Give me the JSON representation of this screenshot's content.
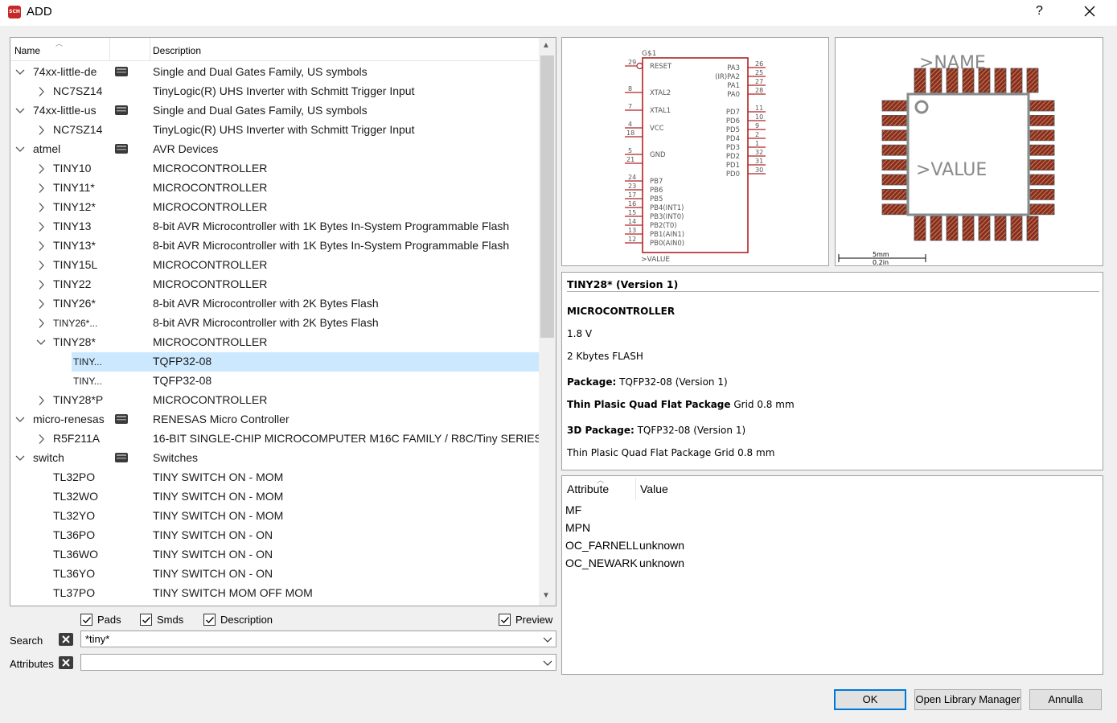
{
  "window": {
    "title": "ADD",
    "help": "?",
    "app_icon_text": "SCH"
  },
  "tree": {
    "header": {
      "name": "Name",
      "description": "Description"
    },
    "rows": [
      {
        "level": 0,
        "arrow": "down",
        "name": "74xx-little-de",
        "lib": true,
        "desc": "Single and Dual Gates Family, US symbols"
      },
      {
        "level": 1,
        "arrow": "right",
        "name": "NC7SZ14",
        "desc": "TinyLogic(R) UHS Inverter with Schmitt Trigger Input"
      },
      {
        "level": 0,
        "arrow": "down",
        "name": "74xx-little-us",
        "lib": true,
        "desc": "Single and Dual Gates Family, US symbols"
      },
      {
        "level": 1,
        "arrow": "right",
        "name": "NC7SZ14",
        "desc": "TinyLogic(R) UHS Inverter with Schmitt Trigger Input"
      },
      {
        "level": 0,
        "arrow": "down",
        "name": "atmel",
        "lib": true,
        "desc": "AVR Devices"
      },
      {
        "level": 1,
        "arrow": "right",
        "name": "TINY10",
        "desc": "MICROCONTROLLER"
      },
      {
        "level": 1,
        "arrow": "right",
        "name": "TINY11*",
        "desc": "MICROCONTROLLER"
      },
      {
        "level": 1,
        "arrow": "right",
        "name": "TINY12*",
        "desc": "MICROCONTROLLER"
      },
      {
        "level": 1,
        "arrow": "right",
        "name": "TINY13",
        "desc": "8-bit AVR Microcontroller with 1K Bytes In-System Programmable Flash"
      },
      {
        "level": 1,
        "arrow": "right",
        "name": "TINY13*",
        "desc": "8-bit AVR Microcontroller with 1K Bytes In-System Programmable Flash"
      },
      {
        "level": 1,
        "arrow": "right",
        "name": "TINY15L",
        "desc": "MICROCONTROLLER"
      },
      {
        "level": 1,
        "arrow": "right",
        "name": "TINY22",
        "desc": "MICROCONTROLLER"
      },
      {
        "level": 1,
        "arrow": "right",
        "name": "TINY26*",
        "desc": "8-bit AVR Microcontroller with 2K Bytes Flash"
      },
      {
        "level": 1,
        "arrow": "right",
        "name": "TINY26*...",
        "desc": "8-bit AVR Microcontroller with 2K Bytes Flash",
        "small": true
      },
      {
        "level": 1,
        "arrow": "down",
        "name": "TINY28*",
        "desc": "MICROCONTROLLER"
      },
      {
        "level": 2,
        "arrow": "",
        "name": "TINY...",
        "desc": "TQFP32-08",
        "selected": true,
        "small": true
      },
      {
        "level": 2,
        "arrow": "",
        "name": "TINY...",
        "desc": "TQFP32-08",
        "small": true
      },
      {
        "level": 1,
        "arrow": "right",
        "name": "TINY28*P",
        "desc": "MICROCONTROLLER"
      },
      {
        "level": 0,
        "arrow": "down",
        "name": "micro-renesas",
        "lib": true,
        "desc": "RENESAS Micro Controller"
      },
      {
        "level": 1,
        "arrow": "right",
        "name": "R5F211A",
        "desc": "16-BIT SINGLE-CHIP MICROCOMPUTER M16C FAMILY / R8C/Tiny SERIES"
      },
      {
        "level": 0,
        "arrow": "down",
        "name": "switch",
        "lib": true,
        "desc": "Switches"
      },
      {
        "level": 1,
        "arrow": "",
        "name": "TL32PO",
        "desc": "TINY SWITCH ON - MOM"
      },
      {
        "level": 1,
        "arrow": "",
        "name": "TL32WO",
        "desc": "TINY SWITCH ON - MOM"
      },
      {
        "level": 1,
        "arrow": "",
        "name": "TL32YO",
        "desc": "TINY SWITCH ON - MOM"
      },
      {
        "level": 1,
        "arrow": "",
        "name": "TL36PO",
        "desc": "TINY SWITCH ON - ON"
      },
      {
        "level": 1,
        "arrow": "",
        "name": "TL36WO",
        "desc": "TINY SWITCH ON - ON"
      },
      {
        "level": 1,
        "arrow": "",
        "name": "TL36YO",
        "desc": "TINY SWITCH ON - ON"
      },
      {
        "level": 1,
        "arrow": "",
        "name": "TL37PO",
        "desc": "TINY SWITCH MOM OFF MOM"
      }
    ]
  },
  "filters": {
    "pads": {
      "label": "Pads",
      "checked": true
    },
    "smds": {
      "label": "Smds",
      "checked": true
    },
    "description": {
      "label": "Description",
      "checked": true
    },
    "preview": {
      "label": "Preview",
      "checked": true
    }
  },
  "search": {
    "label": "Search",
    "value": "*tiny*"
  },
  "attributes_filter": {
    "label": "Attributes",
    "value": ""
  },
  "symbol_preview": {
    "part_name": "G$1",
    "value_label": ">VALUE",
    "left_pins": [
      {
        "num": "29",
        "label": "RESET"
      },
      {
        "num": "8",
        "label": "XTAL2"
      },
      {
        "num": "7",
        "label": "XTAL1"
      },
      {
        "num": "4",
        "num2": "18",
        "label": "VCC"
      },
      {
        "num": "5",
        "num2": "21",
        "label": "GND"
      },
      {
        "num": "24",
        "label": "PB7"
      },
      {
        "num": "23",
        "label": "PB6"
      },
      {
        "num": "17",
        "label": "PB5"
      },
      {
        "num": "16",
        "label": "PB4(INT1)"
      },
      {
        "num": "15",
        "label": "PB3(INT0)"
      },
      {
        "num": "14",
        "label": "PB2(T0)"
      },
      {
        "num": "13",
        "label": "PB1(AIN1)"
      },
      {
        "num": "12",
        "label": "PB0(AIN0)"
      }
    ],
    "right_pins": [
      {
        "num": "26",
        "label": "PA3"
      },
      {
        "num": "25",
        "label": "(IR)PA2"
      },
      {
        "num": "27",
        "label": "PA1"
      },
      {
        "num": "28",
        "label": "PA0"
      },
      {
        "num": "11",
        "label": "PD7"
      },
      {
        "num": "10",
        "label": "PD6"
      },
      {
        "num": "9",
        "label": "PD5"
      },
      {
        "num": "2",
        "label": "PD4"
      },
      {
        "num": "1",
        "label": "PD3"
      },
      {
        "num": "32",
        "label": "PD2"
      },
      {
        "num": "31",
        "label": "PD1"
      },
      {
        "num": "30",
        "label": "PD0"
      }
    ]
  },
  "package_preview": {
    "name_label": ">NAME",
    "value_label": ">VALUE",
    "scale_mm": "5mm",
    "scale_in": "0.2in",
    "pads_per_side": 8
  },
  "info": {
    "title": "TINY28* (Version 1)",
    "heading": "MICROCONTROLLER",
    "line1": "1.8 V",
    "line2": "2 Kbytes FLASH",
    "package_label": "Package:",
    "package_value": " TQFP32-08 (Version 1)",
    "package_desc_bold": "Thin Plasic Quad Flat Package",
    "package_desc_rest": " Grid 0.8 mm",
    "pkg3d_label": "3D Package:",
    "pkg3d_value": " TQFP32-08 (Version 1)",
    "pkg3d_desc": "Thin Plasic Quad Flat Package Grid 0.8 mm"
  },
  "attribute_table": {
    "header": {
      "attribute": "Attribute",
      "value": "Value"
    },
    "rows": [
      {
        "name": "MF",
        "value": ""
      },
      {
        "name": "MPN",
        "value": ""
      },
      {
        "name": "OC_FARNELL",
        "value": "unknown"
      },
      {
        "name": "OC_NEWARK",
        "value": "unknown"
      }
    ]
  },
  "buttons": {
    "ok": "OK",
    "library_manager": "Open Library Manager",
    "cancel": "Annulla"
  },
  "colors": {
    "selection": "#cce8ff",
    "symbol": "#b22222",
    "pad": "#8b2a2a",
    "pad_hatch": "#c9a23a",
    "default_button_border": "#0078d7"
  }
}
